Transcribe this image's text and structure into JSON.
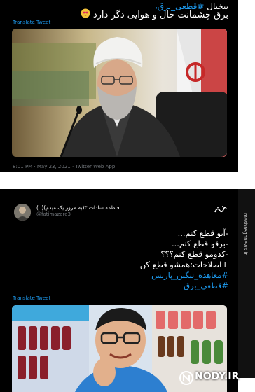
{
  "tweet1": {
    "text_line1_hashtag": "#قطعی_برق،",
    "text_line1_word": "بیخیال",
    "text_line2": "برق چشمانت حال و هوایی دگر دارد",
    "emoji": "heart-eyes-emoji",
    "translate_label": "Translate Tweet",
    "timestamp": "8:01 PM · May 23, 2021 · Twitter Web App"
  },
  "tweet2": {
    "display_name": "فاطمه سادات ۳(به مرور یک میدم)(ـ‌ـ‌)",
    "handle": "@fatimazare3",
    "lines": [
      "-آبو قطع کنم...",
      "-برقو قطع کنم...",
      "-کدومو قطع کنم؟؟؟",
      "+اصلاحات:همشو قطع کن"
    ],
    "hashtags": [
      "#معاهده_ننگین_پاریس",
      "#قطعی_برق"
    ],
    "translate_label": "Translate Tweet"
  },
  "watermarks": {
    "side_text": "mashreghnews.ir",
    "brand": "NODY.IR"
  },
  "colors": {
    "background": "#000000",
    "link": "#1d9bf0",
    "muted": "#71767b"
  }
}
